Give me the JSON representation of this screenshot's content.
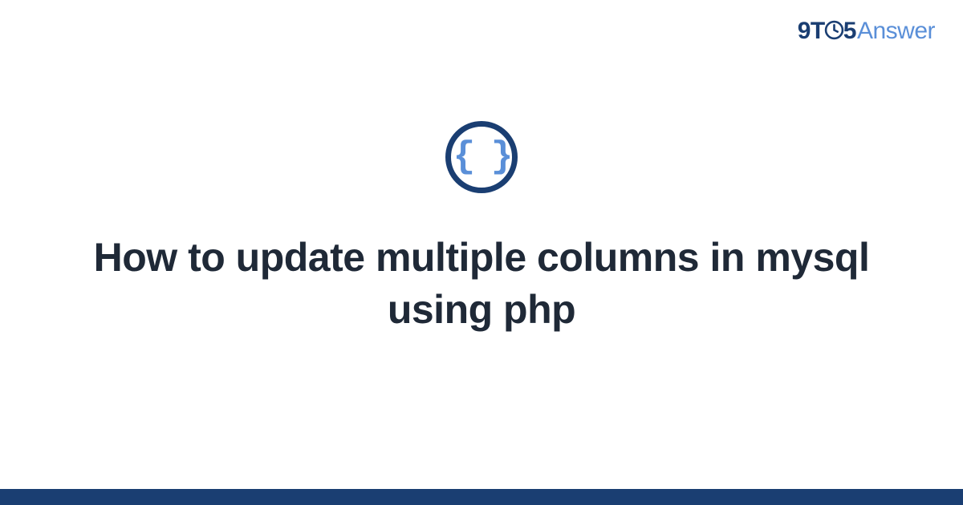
{
  "logo": {
    "part1": "9T",
    "part2": "5",
    "part3": "Answer"
  },
  "icon": {
    "braces": "{ }"
  },
  "title": "How to update multiple columns in mysql using php",
  "colors": {
    "brand_dark": "#1a3e72",
    "brand_light": "#5a8fd8",
    "text": "#1f2937"
  }
}
